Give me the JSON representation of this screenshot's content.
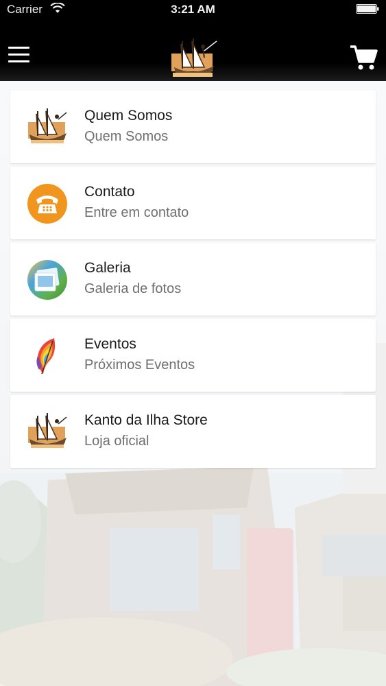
{
  "status_bar": {
    "carrier": "Carrier",
    "time": "3:21 AM",
    "wifi_icon": "wifi-icon",
    "battery_icon": "battery-icon"
  },
  "nav": {
    "menu_icon": "hamburger-menu-icon",
    "logo": "ship-logo",
    "cart_icon": "shopping-cart-icon"
  },
  "menu": {
    "items": [
      {
        "title": "Quem Somos",
        "subtitle": "Quem Somos",
        "icon": "ship-logo-icon"
      },
      {
        "title": "Contato",
        "subtitle": "Entre em contato",
        "icon": "phone-icon",
        "icon_color": "#f0951e"
      },
      {
        "title": "Galeria",
        "subtitle": "Galeria de fotos",
        "icon": "photo-gallery-icon"
      },
      {
        "title": "Eventos",
        "subtitle": "Próximos Eventos",
        "icon": "feather-icon"
      },
      {
        "title": "Kanto da Ilha Store",
        "subtitle": "Loja oficial",
        "icon": "ship-logo-icon"
      }
    ]
  },
  "colors": {
    "nav_background": "#000000",
    "card_background": "#ffffff",
    "title_text": "#1a1a1a",
    "subtitle_text": "#6f6f6f"
  }
}
